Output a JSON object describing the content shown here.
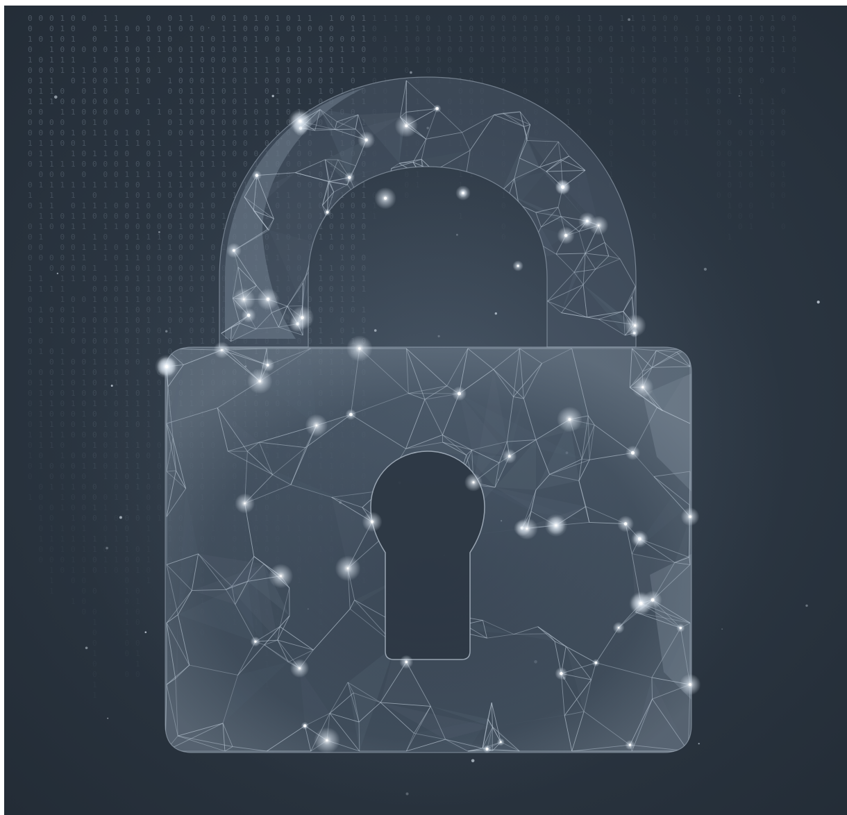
{
  "image": {
    "subject": "padlock-icon",
    "colors": {
      "background": "#2a3440",
      "mesh_line": "#b9c6d3",
      "glow": "#dde7f1",
      "digit": "#7f8d9b",
      "lock_fill": "#5d6c7b"
    },
    "binary_glyphs": [
      "0",
      "1"
    ]
  }
}
